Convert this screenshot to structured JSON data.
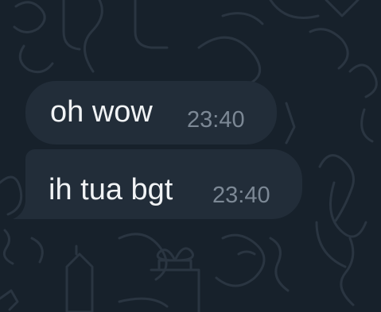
{
  "chat": {
    "messages": [
      {
        "text": "oh wow",
        "time": "23:40"
      },
      {
        "text": "ih tua bgt",
        "time": "23:40"
      }
    ]
  },
  "theme": {
    "background": "#17212b",
    "bubble": "#222d39",
    "text": "#f1f3f5",
    "timestamp": "#7c8895",
    "doodle": "#2a3541"
  }
}
